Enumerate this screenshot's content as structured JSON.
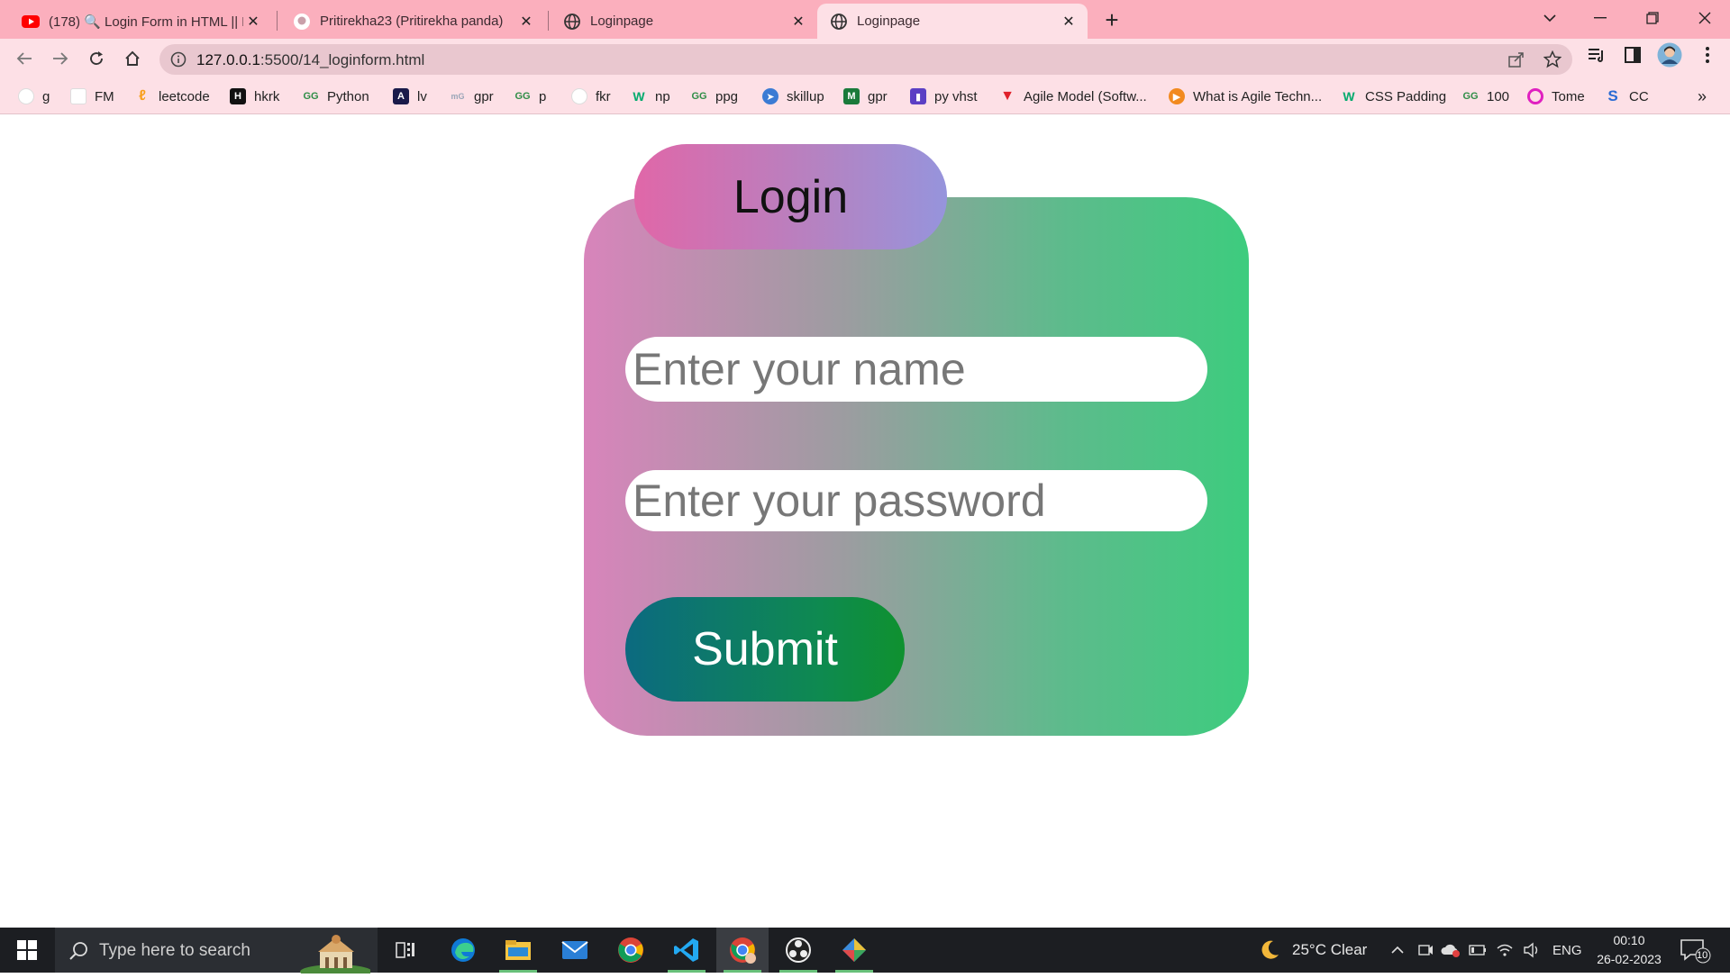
{
  "browser": {
    "tabs": [
      {
        "label": "(178) 🔍 Login Form in HTML || H",
        "icon": "youtube-icon",
        "active": false
      },
      {
        "label": "Pritirekha23 (Pritirekha panda)",
        "icon": "github-icon",
        "active": false
      },
      {
        "label": "Loginpage",
        "icon": "globe-icon",
        "active": false
      },
      {
        "label": "Loginpage",
        "icon": "globe-icon",
        "active": true
      }
    ],
    "url_host": "127.0.0.1",
    "url_path": ":5500/14_loginform.html",
    "bookmarks": [
      {
        "label": "g",
        "icon": "github-icon",
        "color": "#ffffff"
      },
      {
        "label": "FM",
        "icon": "fm-icon",
        "color": "#ffffff"
      },
      {
        "label": "leetcode",
        "icon": "leetcode-icon",
        "color": "#f89f1b"
      },
      {
        "label": "hkrk",
        "icon": "hackerrank-icon",
        "color": "#111111"
      },
      {
        "label": "Python",
        "icon": "geeks-icon",
        "color": "#2f8d46"
      },
      {
        "label": "lv",
        "icon": "lv-icon",
        "color": "#1a1a4a"
      },
      {
        "label": "gpr",
        "icon": "gpr-icon",
        "color": "#9aa6b8"
      },
      {
        "label": "p",
        "icon": "geeks-icon",
        "color": "#2f8d46"
      },
      {
        "label": "fkr",
        "icon": "page-icon",
        "color": "#ffffff"
      },
      {
        "label": "np",
        "icon": "w3schools-icon",
        "color": "#04aa6d"
      },
      {
        "label": "ppg",
        "icon": "geeks-icon",
        "color": "#2f8d46"
      },
      {
        "label": "skillup",
        "icon": "skillup-icon",
        "color": "#3b7bd4"
      },
      {
        "label": "gpr",
        "icon": "gpr-green-icon",
        "color": "#1a7a3a"
      },
      {
        "label": "py vhst",
        "icon": "vhst-icon",
        "color": "#5b3fc4"
      },
      {
        "label": "Agile Model (Softw...",
        "icon": "tutorialspoint-icon",
        "color": "#e0202a"
      },
      {
        "label": "What is Agile Techn...",
        "icon": "play-icon",
        "color": "#f28a1f"
      },
      {
        "label": "CSS Padding",
        "icon": "w3schools-icon",
        "color": "#04aa6d"
      },
      {
        "label": "100",
        "icon": "geeks-icon",
        "color": "#2f8d46"
      },
      {
        "label": "Tome",
        "icon": "tome-icon",
        "color": "#e020c0"
      },
      {
        "label": "CC",
        "icon": "codechef-icon",
        "color": "#2a6bd4"
      }
    ],
    "overflow": "»"
  },
  "page": {
    "heading": "Login",
    "name_placeholder": "Enter your name",
    "password_placeholder": "Enter your password",
    "submit_label": "Submit"
  },
  "taskbar": {
    "search_placeholder": "Type here to search",
    "weather": "25°C  Clear",
    "language": "ENG",
    "time": "00:10",
    "date": "26-02-2023",
    "notifications": "10"
  }
}
